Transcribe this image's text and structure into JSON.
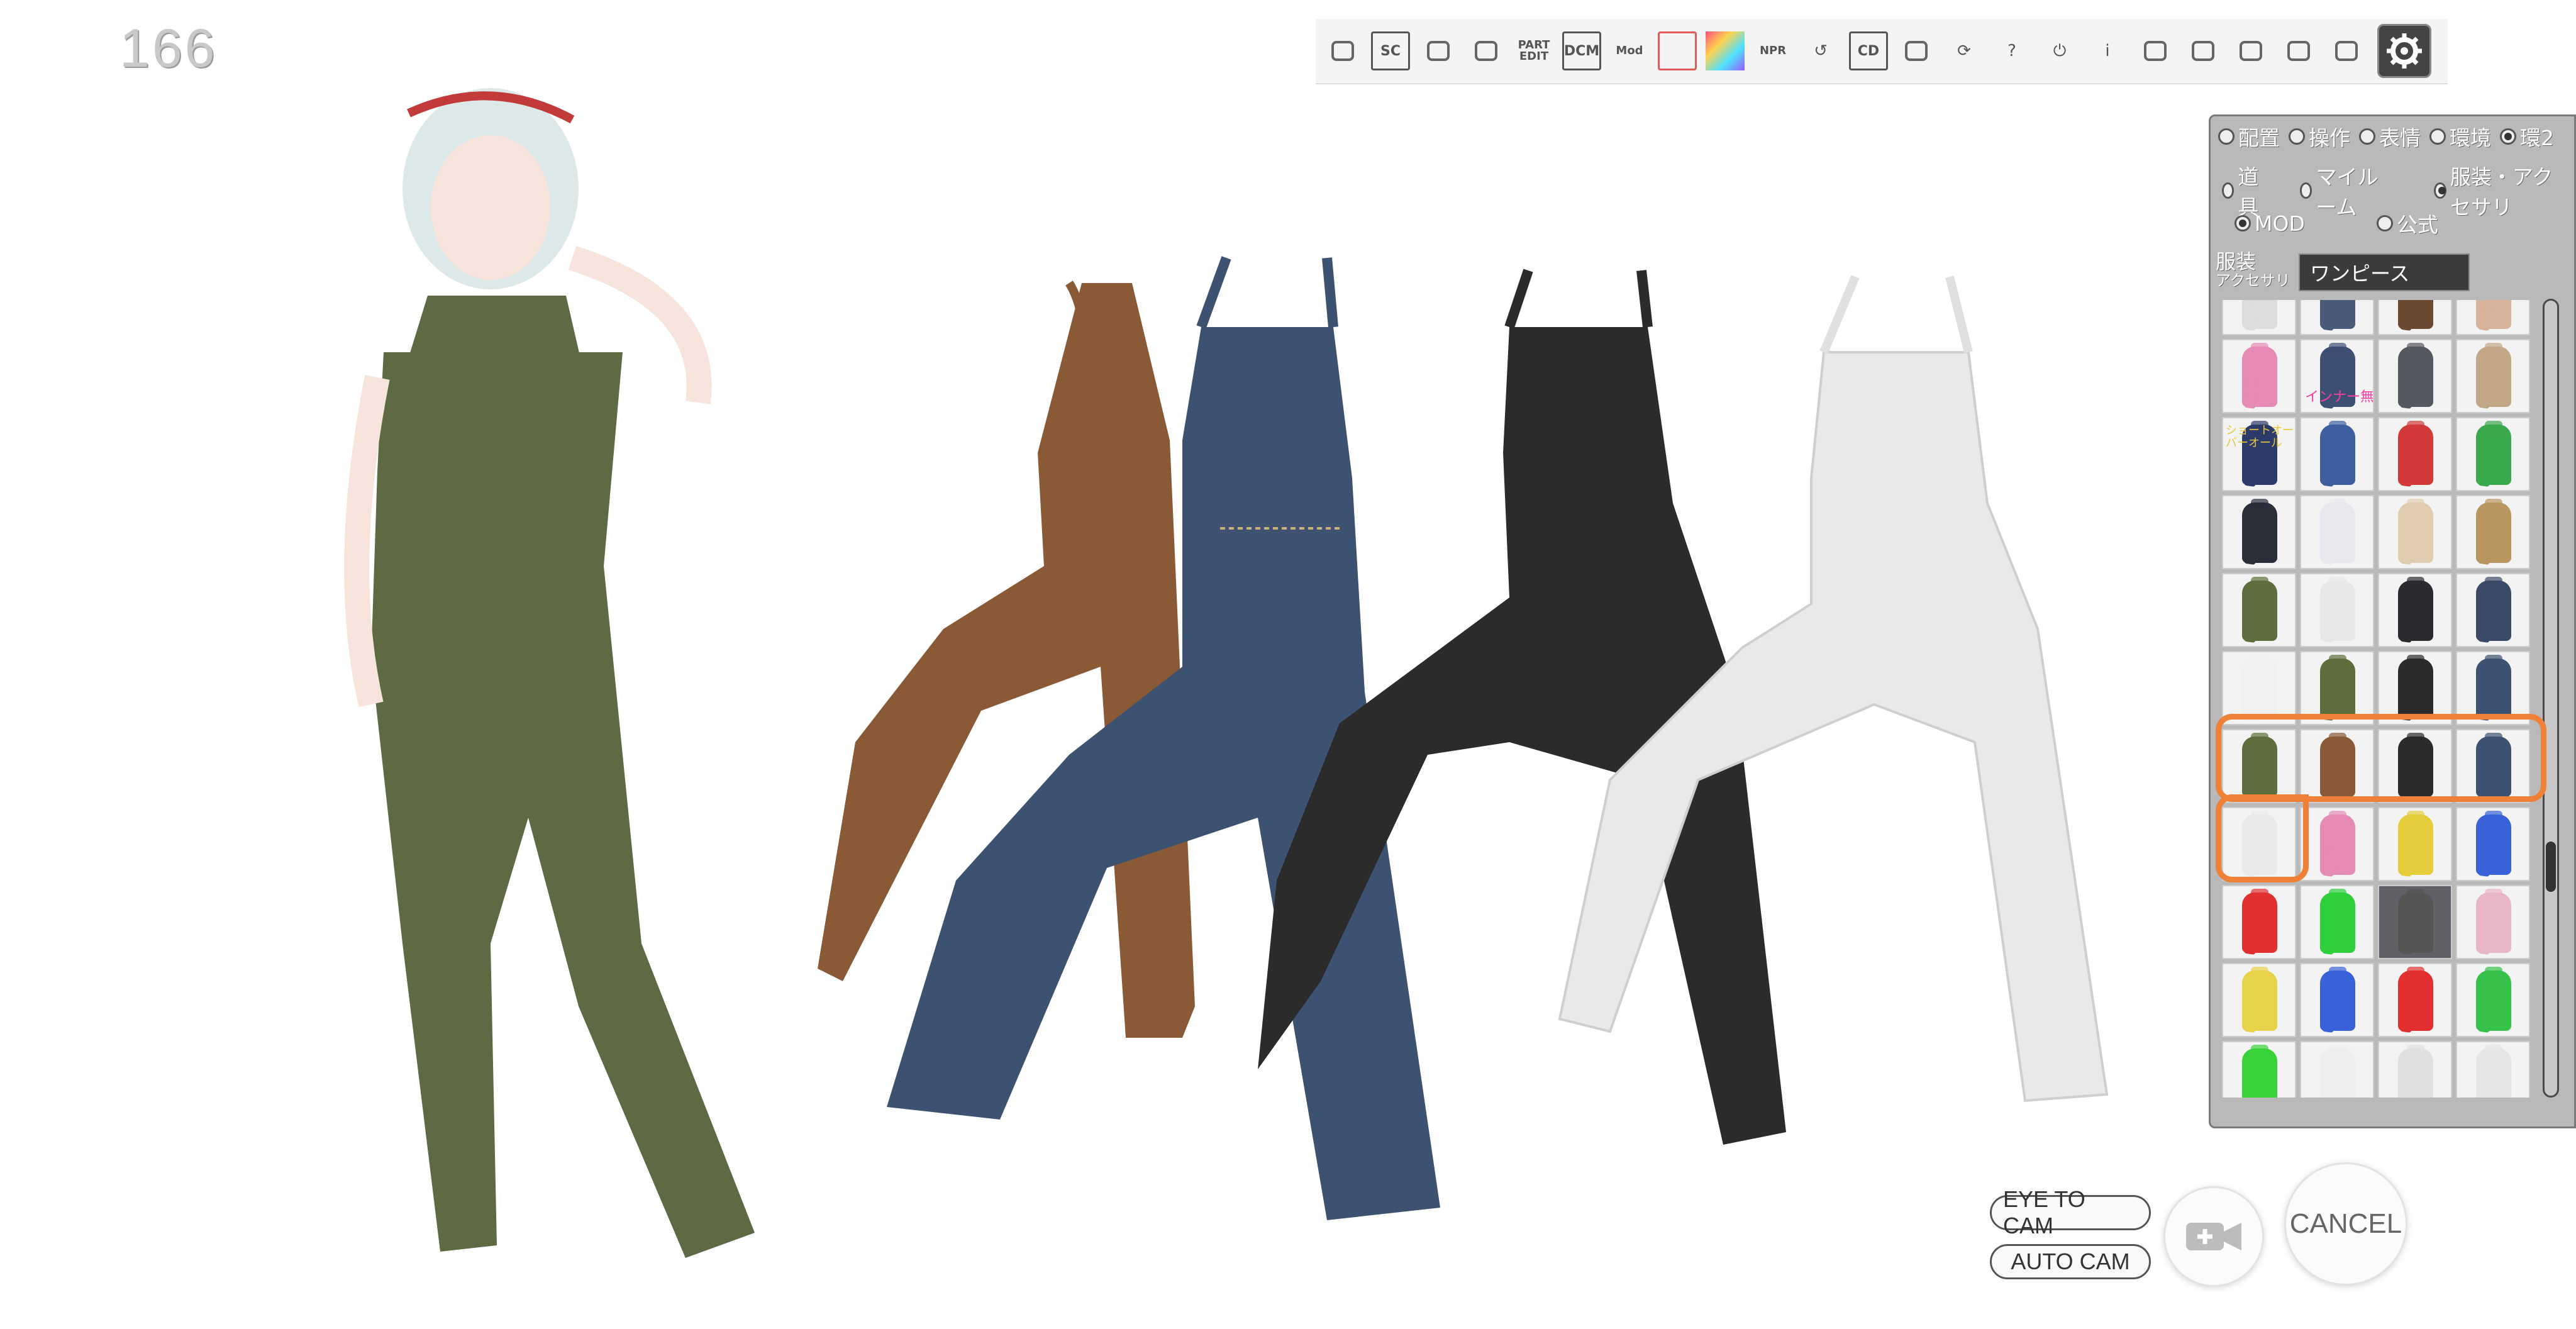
{
  "fps_counter": "166",
  "toolbar": {
    "items": [
      {
        "name": "pose-icon",
        "label": "",
        "kind": "icon"
      },
      {
        "name": "sc-button",
        "label": "SC",
        "kind": "boxed"
      },
      {
        "name": "eye-icon",
        "label": "",
        "kind": "icon"
      },
      {
        "name": "wrench-icon",
        "label": "",
        "kind": "icon"
      },
      {
        "name": "part-edit-button",
        "label": "PART EDIT",
        "kind": "small"
      },
      {
        "name": "dcm-button",
        "label": "DCM",
        "kind": "boxed"
      },
      {
        "name": "mod-button",
        "label": "Mod",
        "kind": "small"
      },
      {
        "name": "device-icon",
        "label": "",
        "kind": "red"
      },
      {
        "name": "color-gradient-icon",
        "label": "",
        "kind": "gradient"
      },
      {
        "name": "npr-button",
        "label": "NPR",
        "kind": "small"
      },
      {
        "name": "undo-icon",
        "label": "↺",
        "kind": "icon"
      },
      {
        "name": "cd-button",
        "label": "CD",
        "kind": "boxed"
      },
      {
        "name": "glasses-icon",
        "label": "",
        "kind": "icon"
      },
      {
        "name": "refresh-icon",
        "label": "⟳",
        "kind": "icon"
      },
      {
        "name": "help-icon",
        "label": "?",
        "kind": "icon"
      },
      {
        "name": "power-icon",
        "label": "⏻",
        "kind": "icon"
      },
      {
        "name": "info-icon",
        "label": "i",
        "kind": "icon"
      },
      {
        "name": "axis-icon",
        "label": "",
        "kind": "icon"
      },
      {
        "name": "basket-icon",
        "label": "",
        "kind": "icon"
      },
      {
        "name": "ui-camera-icon",
        "label": "",
        "kind": "icon"
      },
      {
        "name": "camera-icon",
        "label": "",
        "kind": "icon"
      },
      {
        "name": "gears-icon",
        "label": "",
        "kind": "icon"
      },
      {
        "name": "settings-gear-icon",
        "label": "",
        "kind": "gear"
      }
    ]
  },
  "panel": {
    "tabs_row1": [
      {
        "label": "配置",
        "selected": false
      },
      {
        "label": "操作",
        "selected": false
      },
      {
        "label": "表情",
        "selected": false
      },
      {
        "label": "環境",
        "selected": false
      },
      {
        "label": "環2",
        "selected": true
      }
    ],
    "tabs_row2": [
      {
        "label": "道具",
        "selected": false
      },
      {
        "label": "マイルーム",
        "selected": false
      },
      {
        "label": "服装・アクセサリ",
        "selected": true
      }
    ],
    "source_row": [
      {
        "label": "MOD",
        "selected": true
      },
      {
        "label": "公式",
        "selected": false
      }
    ],
    "category_label": "服装",
    "category_sub": "アクセサリ",
    "category_select": "ワンピース",
    "grid_captions": {
      "cell_r1c2": "インナー無",
      "cell_r2c1": "ショートオーバーオール"
    },
    "colors": {
      "highlight": "#ee8038",
      "panel_bg": "#b9b9b9"
    }
  },
  "bottom": {
    "eye_to_cam": "EYE TO CAM",
    "auto_cam": "AUTO CAM",
    "cancel": "CANCEL",
    "add_camera_icon": "video-camera-plus-icon"
  }
}
